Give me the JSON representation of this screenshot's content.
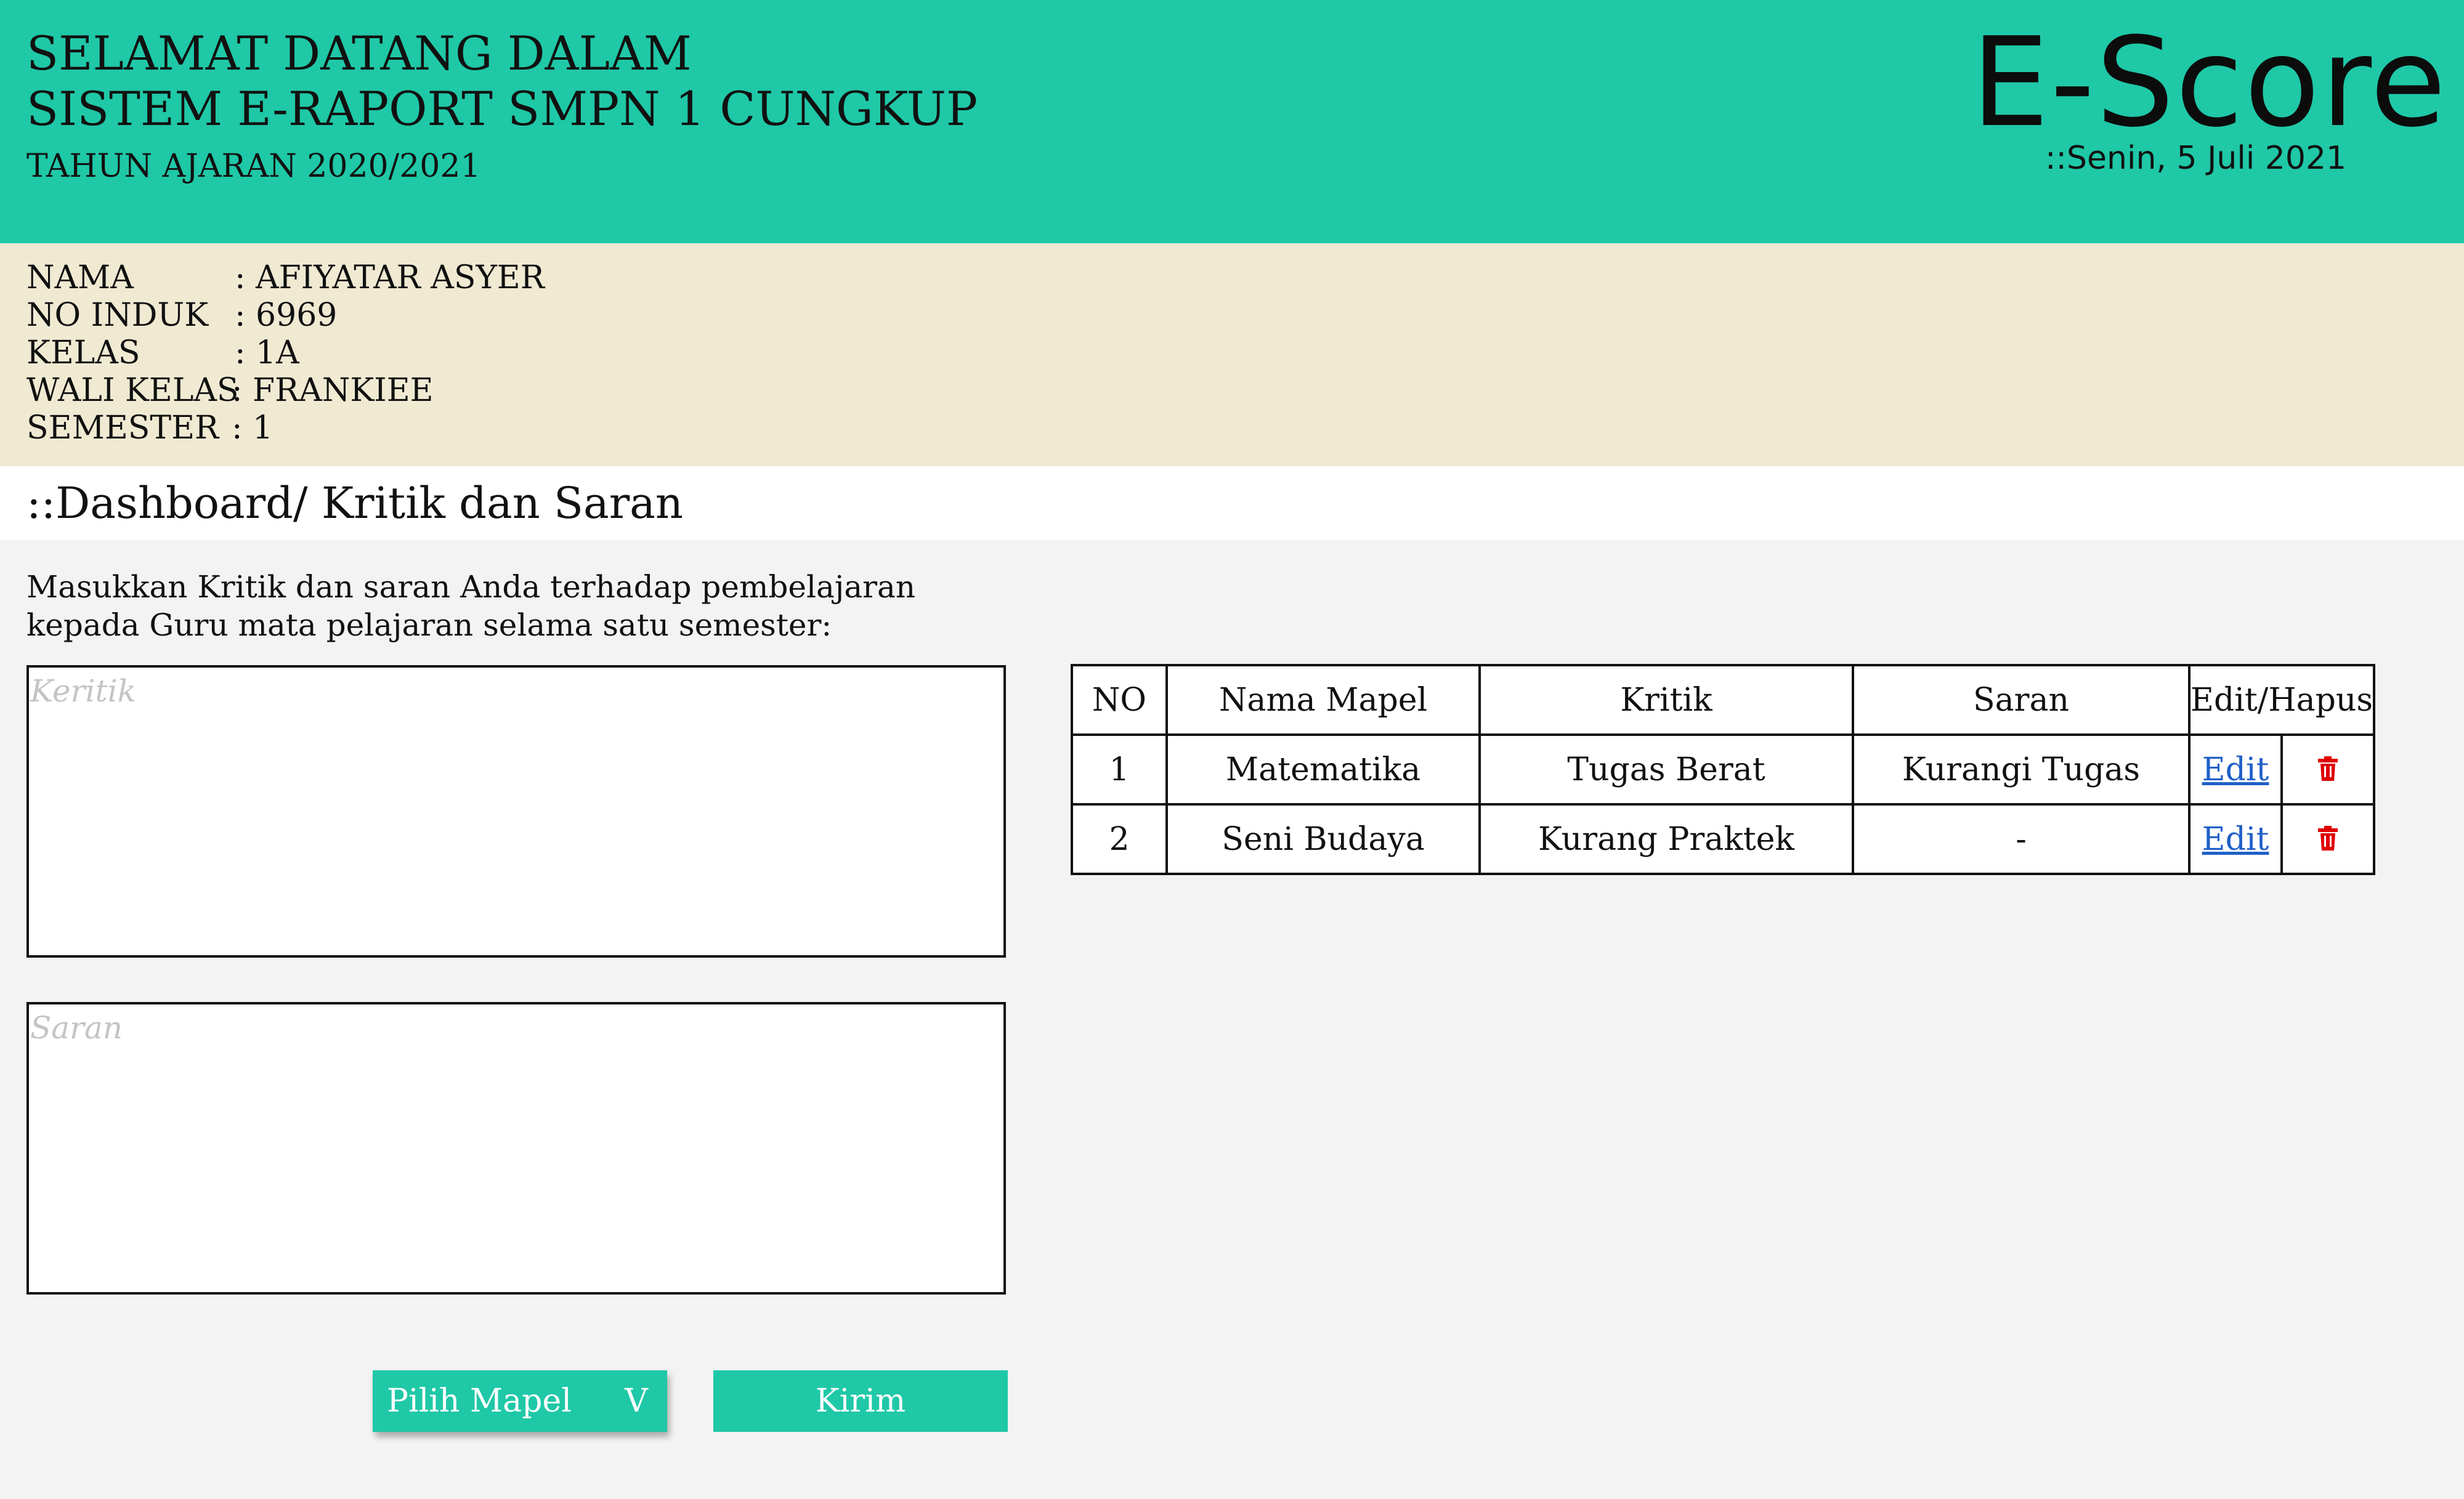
{
  "header": {
    "welcome_line1": "SELAMAT DATANG DALAM",
    "welcome_line2": "SISTEM E-RAPORT SMPN 1 CUNGKUP",
    "academic_year": "TAHUN AJARAN 2020/2021",
    "brand": "E-Score",
    "date": "::Senin, 5 Juli 2021",
    "color": "#1fc8a7"
  },
  "student": {
    "nama_label": "NAMA",
    "nama_value": ":  AFIYATAR ASYER",
    "induk_label": "NO INDUK",
    "induk_value": ": 6969",
    "kelas_label": "KELAS",
    "kelas_value": ": 1A",
    "wali_label": "WALI KELAS",
    "wali_value": ": FRANKIEE",
    "semester_label": "SEMESTER",
    "semester_value": ": 1",
    "background": "#f0ead3"
  },
  "breadcrumb": "::Dashboard/ Kritik dan Saran",
  "form": {
    "instruction": "Masukkan Kritik dan saran Anda terhadap pembelajaran kepada Guru mata pelajaran selama satu semester:",
    "kritik_placeholder": "Keritik",
    "saran_placeholder": "Saran",
    "select_label": "Pilih Mapel",
    "select_arrow": "V",
    "submit_label": "Kirim"
  },
  "table": {
    "headers": [
      "NO",
      "Nama Mapel",
      "Kritik",
      "Saran",
      "Edit/Hapus"
    ],
    "rows": [
      {
        "no": "1",
        "mapel": "Matematika",
        "kritik": "Tugas Berat",
        "saran": "Kurangi Tugas",
        "edit": "Edit"
      },
      {
        "no": "2",
        "mapel": "Seni Budaya",
        "kritik": "Kurang Praktek",
        "saran": "-",
        "edit": "Edit"
      }
    ],
    "delete_icon": "trash-icon",
    "delete_color": "#e00000"
  }
}
